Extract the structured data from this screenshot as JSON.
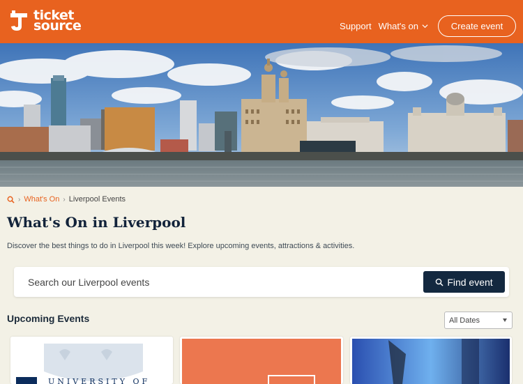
{
  "header": {
    "logo_line1": "ticket",
    "logo_line2": "source",
    "nav": {
      "support": "Support",
      "whats_on": "What's on",
      "create_event": "Create event"
    },
    "brand_color": "#e8621f"
  },
  "breadcrumb": {
    "home_icon": "search-icon",
    "items": [
      "What's On",
      "Liverpool Events"
    ]
  },
  "page": {
    "title": "What's On in Liverpool",
    "intro": "Discover the best things to do in Liverpool this week! Explore upcoming events, attractions & activities."
  },
  "search": {
    "placeholder": "Search our Liverpool events",
    "button_label": "Find event",
    "button_icon": "search-icon"
  },
  "events": {
    "heading": "Upcoming Events",
    "date_filter": {
      "selected": "All Dates"
    },
    "cards": [
      {
        "image": "university-of-liverpool-logo",
        "visible_text": "UNIVERSITY OF"
      },
      {
        "image": "orange-tile-with-logo"
      },
      {
        "image": "stage-performer-photo"
      }
    ]
  },
  "colors": {
    "accent": "#e8621f",
    "navy": "#13283f",
    "background": "#f3f1e6"
  }
}
